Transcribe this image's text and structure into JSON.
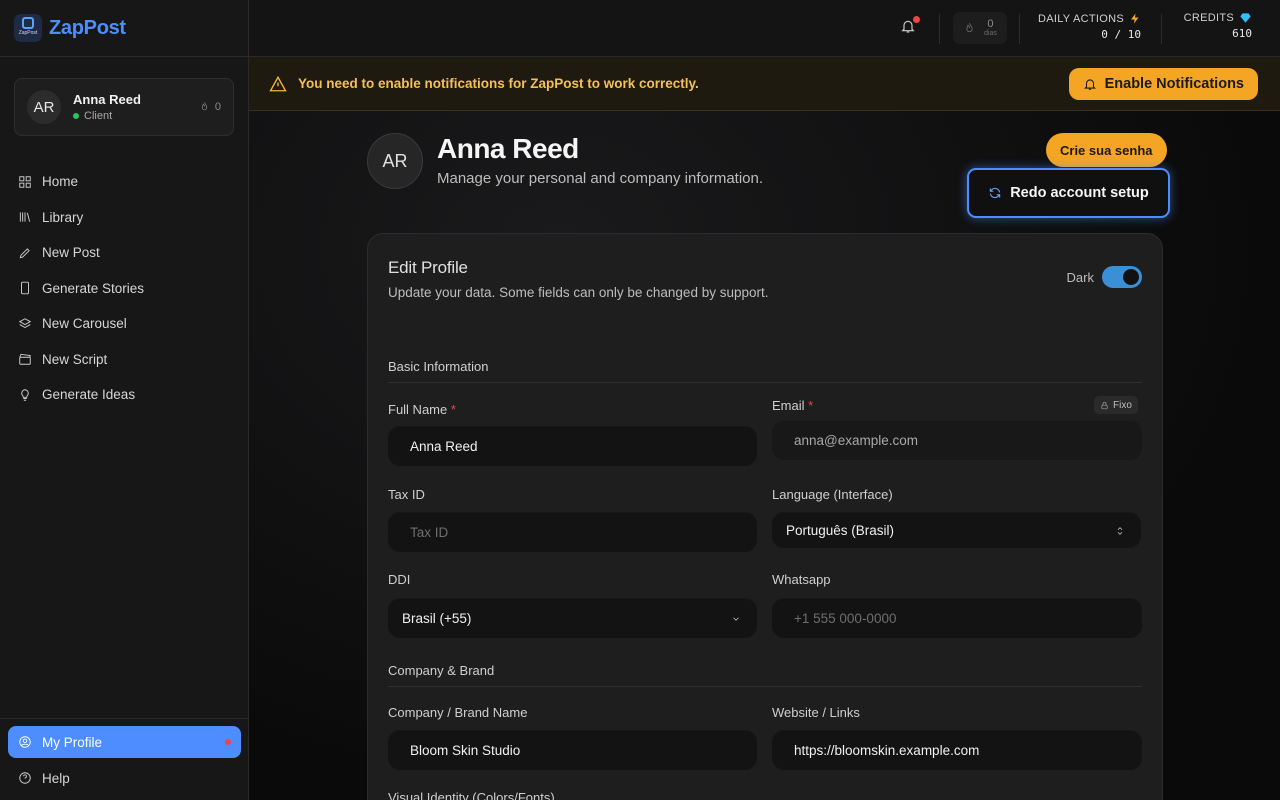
{
  "app": {
    "name": "ZapPost",
    "logo_text": "ZapPost"
  },
  "user": {
    "initials": "AR",
    "name": "Anna Reed",
    "role": "Client",
    "streak": "0"
  },
  "nav": {
    "items": [
      {
        "label": "Home",
        "icon": "grid-icon"
      },
      {
        "label": "Library",
        "icon": "library-icon"
      },
      {
        "label": "New Post",
        "icon": "pen-icon"
      },
      {
        "label": "Generate Stories",
        "icon": "phone-icon"
      },
      {
        "label": "New Carousel",
        "icon": "layers-icon"
      },
      {
        "label": "New Script",
        "icon": "clapper-icon"
      },
      {
        "label": "Generate Ideas",
        "icon": "bulb-icon"
      }
    ],
    "profile": "My Profile",
    "help": "Help"
  },
  "topbar": {
    "streak_value": "0",
    "streak_unit": "dias",
    "daily_actions_label": "DAILY ACTIONS",
    "daily_actions_value": "0 / 10",
    "credits_label": "CREDITS",
    "credits_value": "610"
  },
  "banner": {
    "text": "You need to enable notifications for ZapPost to work correctly.",
    "button": "Enable Notifications"
  },
  "profile": {
    "initials": "AR",
    "name": "Anna Reed",
    "subtitle": "Manage your personal and company information.",
    "password_button": "Crie sua senha",
    "redo_button": "Redo account setup"
  },
  "form": {
    "title": "Edit Profile",
    "subtitle": "Update your data. Some fields can only be changed by support.",
    "theme_label": "Dark",
    "basic_section": "Basic Information",
    "full_name_label": "Full Name",
    "full_name_value": "Anna Reed",
    "email_label": "Email",
    "email_value": "anna@example.com",
    "fixo_badge": "Fixo",
    "tax_label": "Tax ID",
    "tax_placeholder": "Tax ID",
    "language_label": "Language (Interface)",
    "language_value": "Português (Brasil)",
    "ddi_label": "DDI",
    "ddi_value": "Brasil (+55)",
    "whatsapp_label": "Whatsapp",
    "whatsapp_placeholder": "+1 555 000-0000",
    "company_section": "Company & Brand",
    "company_label": "Company / Brand Name",
    "company_value": "Bloom Skin Studio",
    "website_label": "Website / Links",
    "website_value": "https://bloomskin.example.com",
    "visual_label": "Visual Identity (Colors/Fonts)",
    "required_mark": "*"
  },
  "colors": {
    "accent": "#4d8dff",
    "warning": "#f5a524",
    "danger": "#ef4444"
  }
}
